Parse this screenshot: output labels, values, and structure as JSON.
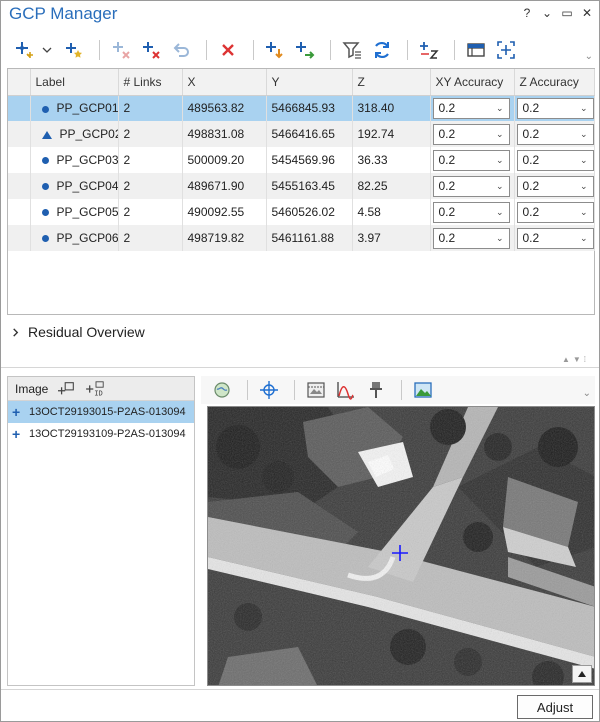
{
  "window": {
    "title": "GCP Manager",
    "controls": [
      "?",
      "⌄",
      "▭",
      "✕"
    ]
  },
  "toolbar": {
    "icons": [
      "add-gcp-icon",
      "dropdown-icon",
      "add-tie-point-icon",
      "delete-unlinked-icon",
      "delete-link-icon",
      "undo-icon",
      "delete-icon",
      "import-icon",
      "export-icon",
      "filter-icon",
      "refresh-icon",
      "set-z-icon",
      "table-view-icon",
      "zoom-to-icon"
    ]
  },
  "table": {
    "columns": [
      "Label",
      "# Links",
      "X",
      "Y",
      "Z",
      "XY Accuracy",
      "Z Accuracy"
    ],
    "rows": [
      {
        "symbol": "dot",
        "label": "PP_GCP01",
        "links": "2",
        "x": "489563.82",
        "y": "5466845.93",
        "z": "318.40",
        "xy_acc": "0.2",
        "z_acc": "0.2",
        "selected": true
      },
      {
        "symbol": "triangle",
        "label": "PP_GCP02",
        "links": "2",
        "x": "498831.08",
        "y": "5466416.65",
        "z": "192.74",
        "xy_acc": "0.2",
        "z_acc": "0.2",
        "selected": false
      },
      {
        "symbol": "dot",
        "label": "PP_GCP03",
        "links": "2",
        "x": "500009.20",
        "y": "5454569.96",
        "z": "36.33",
        "xy_acc": "0.2",
        "z_acc": "0.2",
        "selected": false
      },
      {
        "symbol": "dot",
        "label": "PP_GCP04",
        "links": "2",
        "x": "489671.90",
        "y": "5455163.45",
        "z": "82.25",
        "xy_acc": "0.2",
        "z_acc": "0.2",
        "selected": false
      },
      {
        "symbol": "dot",
        "label": "PP_GCP05",
        "links": "2",
        "x": "490092.55",
        "y": "5460526.02",
        "z": "4.58",
        "xy_acc": "0.2",
        "z_acc": "0.2",
        "selected": false
      },
      {
        "symbol": "dot",
        "label": "PP_GCP06",
        "links": "2",
        "x": "498719.82",
        "y": "5461161.88",
        "z": "3.97",
        "xy_acc": "0.2",
        "z_acc": "0.2",
        "selected": false
      }
    ]
  },
  "residual": {
    "label": "Residual Overview"
  },
  "images": {
    "header": "Image",
    "items": [
      {
        "name": "13OCT29193015-P2AS-013094",
        "selected": true
      },
      {
        "name": "13OCT29193109-P2AS-013094",
        "selected": false
      }
    ]
  },
  "footer": {
    "adjust_label": "Adjust"
  },
  "colors": {
    "accent": "#2a6ebb",
    "selection": "#a9d2f0",
    "point": "#1f5fb0"
  }
}
